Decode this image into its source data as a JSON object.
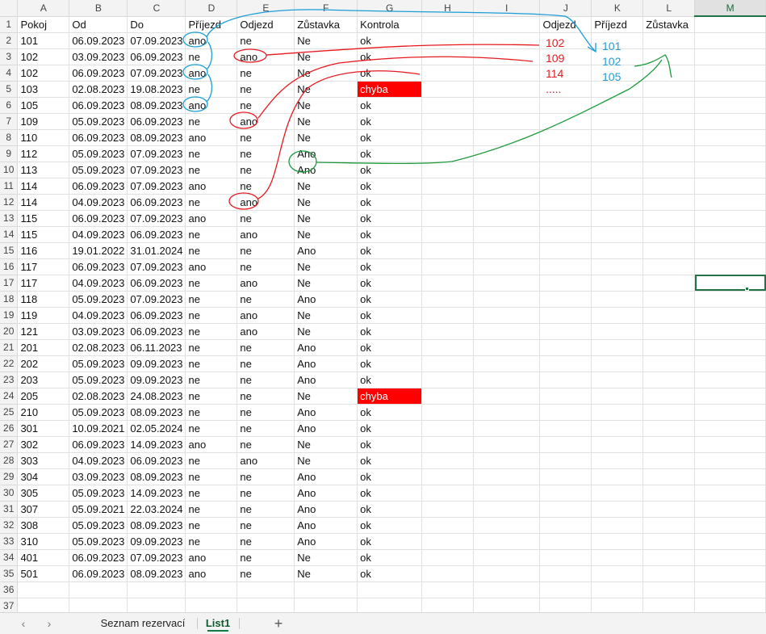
{
  "spreadsheet": {
    "columns": [
      "A",
      "B",
      "C",
      "D",
      "E",
      "F",
      "G",
      "H",
      "I",
      "J",
      "K",
      "L",
      "M"
    ],
    "header": [
      "Pokoj",
      "Od",
      "Do",
      "Příjezd",
      "Odjezd",
      "Zůstavka",
      "Kontrola",
      "",
      "",
      "Odjezd",
      "Příjezd",
      "Zůstavka",
      ""
    ],
    "rows": [
      [
        "101",
        "06.09.2023",
        "07.09.2023",
        "ano",
        "ne",
        "Ne",
        "ok"
      ],
      [
        "102",
        "03.09.2023",
        "06.09.2023",
        "ne",
        "ano",
        "Ne",
        "ok"
      ],
      [
        "102",
        "06.09.2023",
        "07.09.2023",
        "ano",
        "ne",
        "Ne",
        "ok"
      ],
      [
        "103",
        "02.08.2023",
        "19.08.2023",
        "ne",
        "ne",
        "Ne",
        "chyba"
      ],
      [
        "105",
        "06.09.2023",
        "08.09.2023",
        "ano",
        "ne",
        "Ne",
        "ok"
      ],
      [
        "109",
        "05.09.2023",
        "06.09.2023",
        "ne",
        "ano",
        "Ne",
        "ok"
      ],
      [
        "110",
        "06.09.2023",
        "08.09.2023",
        "ano",
        "ne",
        "Ne",
        "ok"
      ],
      [
        "112",
        "05.09.2023",
        "07.09.2023",
        "ne",
        "ne",
        "Ano",
        "ok"
      ],
      [
        "113",
        "05.09.2023",
        "07.09.2023",
        "ne",
        "ne",
        "Ano",
        "ok"
      ],
      [
        "114",
        "06.09.2023",
        "07.09.2023",
        "ano",
        "ne",
        "Ne",
        "ok"
      ],
      [
        "114",
        "04.09.2023",
        "06.09.2023",
        "ne",
        "ano",
        "Ne",
        "ok"
      ],
      [
        "115",
        "06.09.2023",
        "07.09.2023",
        "ano",
        "ne",
        "Ne",
        "ok"
      ],
      [
        "115",
        "04.09.2023",
        "06.09.2023",
        "ne",
        "ano",
        "Ne",
        "ok"
      ],
      [
        "116",
        "19.01.2022",
        "31.01.2024",
        "ne",
        "ne",
        "Ano",
        "ok"
      ],
      [
        "117",
        "06.09.2023",
        "07.09.2023",
        "ano",
        "ne",
        "Ne",
        "ok"
      ],
      [
        "117",
        "04.09.2023",
        "06.09.2023",
        "ne",
        "ano",
        "Ne",
        "ok"
      ],
      [
        "118",
        "05.09.2023",
        "07.09.2023",
        "ne",
        "ne",
        "Ano",
        "ok"
      ],
      [
        "119",
        "04.09.2023",
        "06.09.2023",
        "ne",
        "ano",
        "Ne",
        "ok"
      ],
      [
        "121",
        "03.09.2023",
        "06.09.2023",
        "ne",
        "ano",
        "Ne",
        "ok"
      ],
      [
        "201",
        "02.08.2023",
        "06.11.2023",
        "ne",
        "ne",
        "Ano",
        "ok"
      ],
      [
        "202",
        "05.09.2023",
        "09.09.2023",
        "ne",
        "ne",
        "Ano",
        "ok"
      ],
      [
        "203",
        "05.09.2023",
        "09.09.2023",
        "ne",
        "ne",
        "Ano",
        "ok"
      ],
      [
        "205",
        "02.08.2023",
        "24.08.2023",
        "ne",
        "ne",
        "Ne",
        "chyba"
      ],
      [
        "210",
        "05.09.2023",
        "08.09.2023",
        "ne",
        "ne",
        "Ano",
        "ok"
      ],
      [
        "301",
        "10.09.2021",
        "02.05.2024",
        "ne",
        "ne",
        "Ano",
        "ok"
      ],
      [
        "302",
        "06.09.2023",
        "14.09.2023",
        "ano",
        "ne",
        "Ne",
        "ok"
      ],
      [
        "303",
        "04.09.2023",
        "06.09.2023",
        "ne",
        "ano",
        "Ne",
        "ok"
      ],
      [
        "304",
        "03.09.2023",
        "08.09.2023",
        "ne",
        "ne",
        "Ano",
        "ok"
      ],
      [
        "305",
        "05.09.2023",
        "14.09.2023",
        "ne",
        "ne",
        "Ano",
        "ok"
      ],
      [
        "307",
        "05.09.2021",
        "22.03.2024",
        "ne",
        "ne",
        "Ano",
        "ok"
      ],
      [
        "308",
        "05.09.2023",
        "08.09.2023",
        "ne",
        "ne",
        "Ano",
        "ok"
      ],
      [
        "310",
        "05.09.2023",
        "09.09.2023",
        "ne",
        "ne",
        "Ano",
        "ok"
      ],
      [
        "401",
        "06.09.2023",
        "07.09.2023",
        "ano",
        "ne",
        "Ne",
        "ok"
      ],
      [
        "501",
        "06.09.2023",
        "08.09.2023",
        "ano",
        "ne",
        "Ne",
        "ok"
      ]
    ],
    "extra_row_numbers": [
      "36",
      "37"
    ],
    "error_value": "chyba",
    "selected_cell": {
      "row": "17",
      "col": "M"
    }
  },
  "annotations": {
    "odjezd_list": [
      "102",
      "109",
      "114",
      "....."
    ],
    "prijezd_list": [
      "101",
      "102",
      "105"
    ],
    "colors": {
      "red": "#e8191e",
      "blue": "#1b9dd8",
      "green": "#1e9a3c"
    }
  },
  "tabbar": {
    "nav_prev": "‹",
    "nav_next": "›",
    "sheets": [
      "Seznam rezervací",
      "List1"
    ],
    "active_sheet": "List1",
    "add_label": "+"
  },
  "colors": {
    "accent": "#217346",
    "error_fill": "#ff0000"
  }
}
